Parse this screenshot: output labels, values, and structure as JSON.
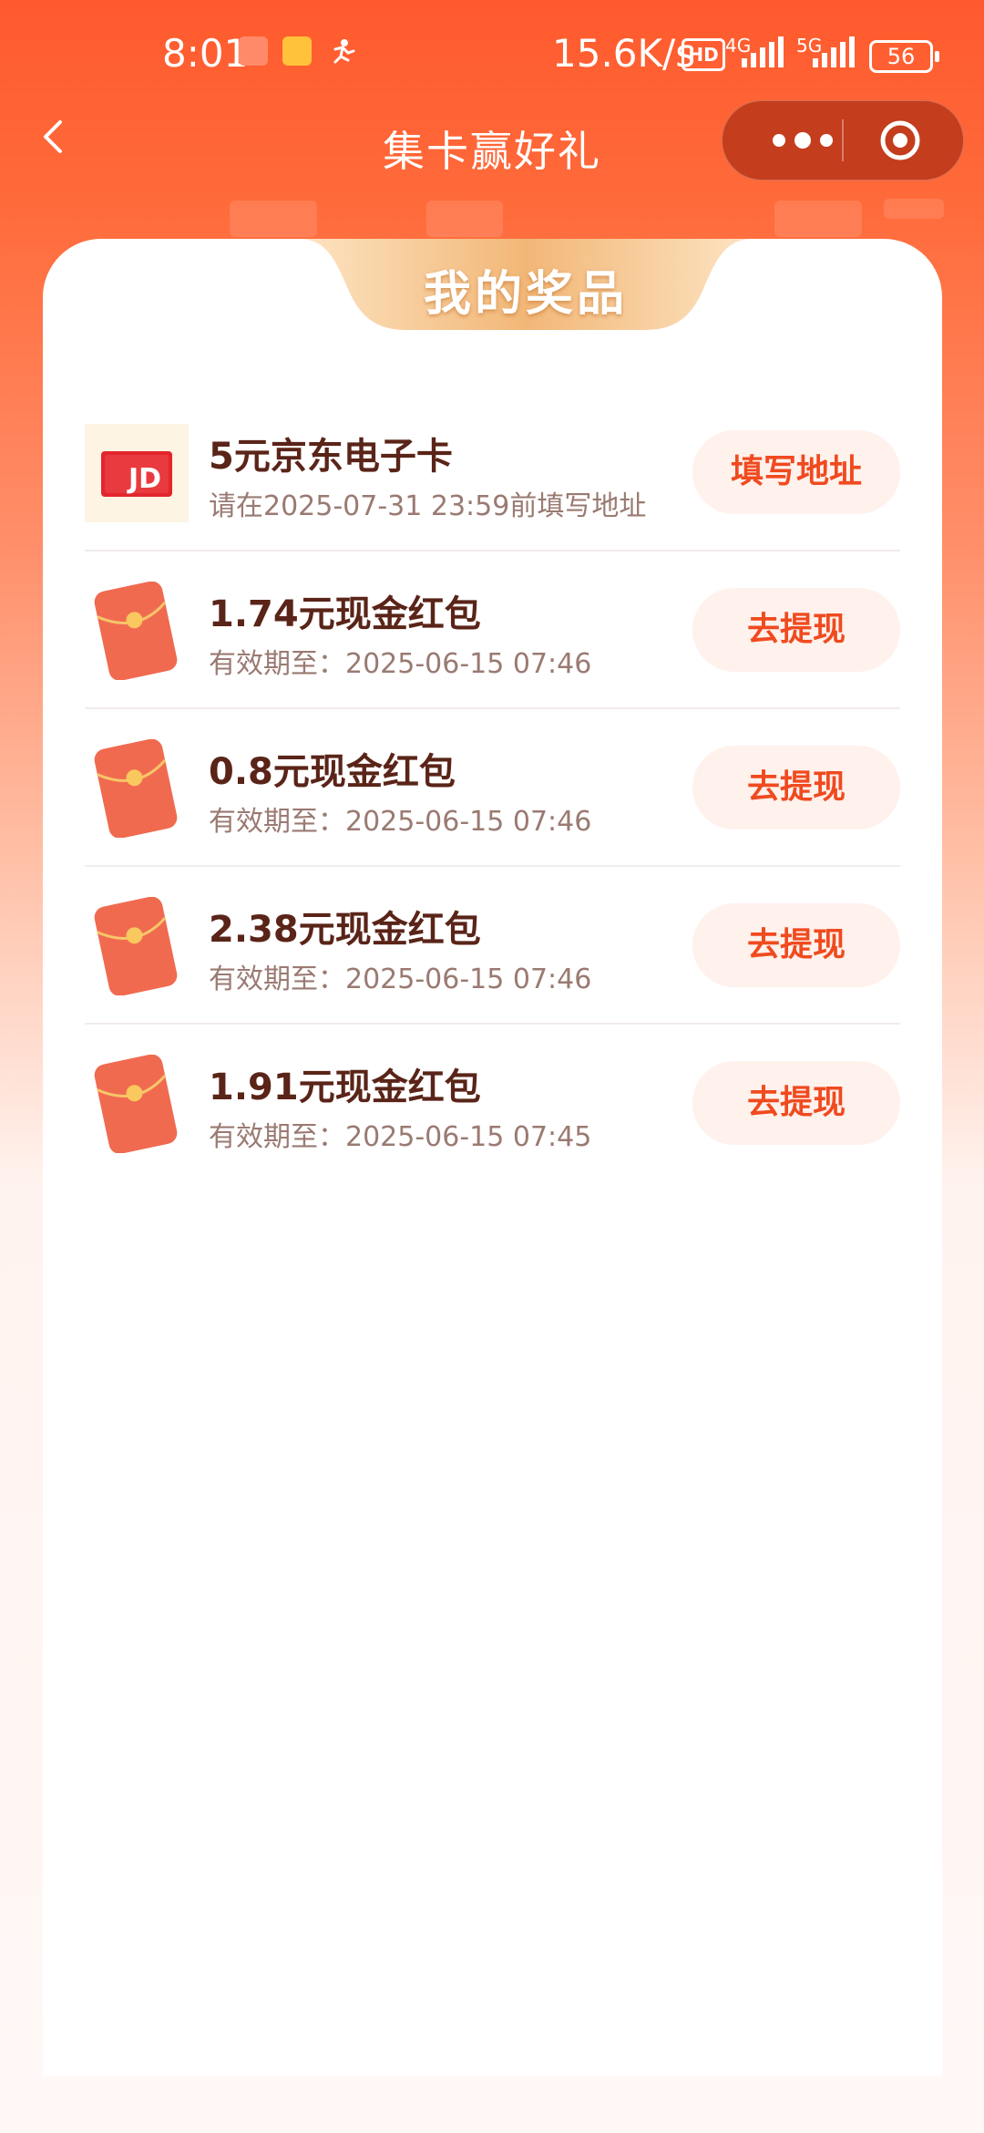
{
  "status_bar": {
    "time": "8:01",
    "network_speed": "15.6K/s",
    "hd_badge": "HD",
    "net_4g": "4G",
    "net_5g": "5G",
    "battery": "56"
  },
  "nav": {
    "title": "集卡赢好礼"
  },
  "card": {
    "header": "我的奖品",
    "items": [
      {
        "type": "jd-card",
        "name": "5元京东电子卡",
        "sub": "请在2025-07-31 23:59前填写地址",
        "button": "填写地址"
      },
      {
        "type": "red-packet",
        "name": "1.74元现金红包",
        "sub": "有效期至：2025-06-15 07:46",
        "button": "去提现"
      },
      {
        "type": "red-packet",
        "name": "0.8元现金红包",
        "sub": "有效期至：2025-06-15 07:46",
        "button": "去提现"
      },
      {
        "type": "red-packet",
        "name": "2.38元现金红包",
        "sub": "有效期至：2025-06-15 07:46",
        "button": "去提现"
      },
      {
        "type": "red-packet",
        "name": "1.91元现金红包",
        "sub": "有效期至：2025-06-15 07:45",
        "button": "去提现"
      }
    ]
  },
  "colors": {
    "brand_orange": "#ff5a2e",
    "button_text": "#f04a1f",
    "title_text": "#5a2418"
  }
}
